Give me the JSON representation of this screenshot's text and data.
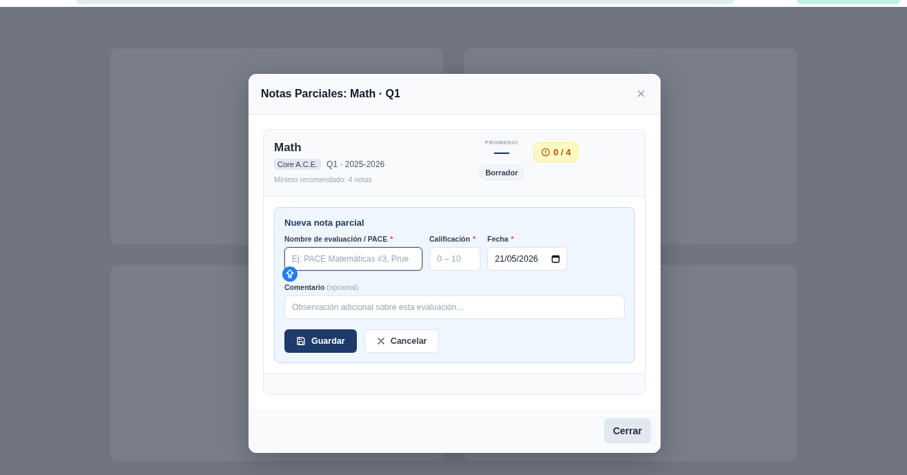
{
  "modal": {
    "title": "Notas Parciales: Math · Q1",
    "close_glyph": "×",
    "subject": {
      "name": "Math",
      "tag": "Core A.C.E.",
      "period": "Q1 · 2025-2026",
      "minimum": "Mínimo recomendado: 4 notas",
      "average_label": "PROMEDIO",
      "average_value": "—",
      "count_badge": "0 / 4",
      "status": "Borrador"
    },
    "form": {
      "title": "Nueva nota parcial",
      "fields": [
        {
          "kind": "text",
          "label": "Nombre de evaluación / PACE",
          "required_mark": "*",
          "placeholder": "Ej: PACE Matemáticas #3, Prue",
          "focused": true
        },
        {
          "kind": "text",
          "label": "Calificación",
          "required_mark": "*",
          "placeholder": "0 – 10",
          "focused": false
        },
        {
          "kind": "date",
          "label": "Fecha",
          "required_mark": "*",
          "value": "21/05/2026",
          "focused": false
        }
      ],
      "comment": {
        "label": "Comentario",
        "hint": "(opcional)",
        "placeholder": "Observación adicional sobre esta evaluación..."
      },
      "buttons": [
        {
          "kind": "primary",
          "label": "Guardar"
        },
        {
          "kind": "secondary",
          "label": "Cancelar"
        }
      ]
    },
    "footer_button": "Cerrar"
  }
}
